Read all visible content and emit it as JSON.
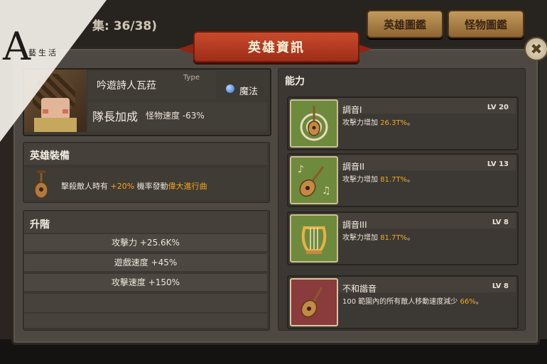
{
  "background": {
    "counter_text": "集: 36/38)",
    "tabs": [
      "英雄圖鑑",
      "怪物圖鑑"
    ]
  },
  "dialog": {
    "title": "英雄資訊",
    "close_glyph": "✖"
  },
  "hero": {
    "name": "吟遊詩人瓦菈",
    "type_label": "Type",
    "type_value": "魔法",
    "leader_label": "隊長加成",
    "leader_effect": "怪物速度 -63%"
  },
  "equipment": {
    "title": "英雄裝備",
    "desc_prefix": "擊殺敵人時有 ",
    "desc_chance": "+20%",
    "desc_middle": " 機率發動",
    "desc_effect": "偉大進行曲"
  },
  "upgrade": {
    "title": "升階",
    "stats": [
      "攻擊力 +25.6K%",
      "遊戲速度 +45%",
      "攻擊速度 +150%"
    ]
  },
  "abilities": {
    "title": "能力",
    "skills": [
      {
        "name": "調音I",
        "level": "LV 20",
        "desc_prefix": "攻擊力增加 ",
        "value": "26.3T%",
        "desc_suffix": "。",
        "icon": "lute-target-icon"
      },
      {
        "name": "調音II",
        "level": "LV 13",
        "desc_prefix": "攻擊力增加 ",
        "value": "81.7T%",
        "desc_suffix": "。",
        "icon": "lute-notes-icon"
      },
      {
        "name": "調音III",
        "level": "LV 8",
        "desc_prefix": "攻擊力增加 ",
        "value": "81.7T%",
        "desc_suffix": "。",
        "icon": "lyre-icon"
      },
      {
        "name": "不和諧音",
        "level": "LV 8",
        "desc_prefix": "100 範圍內的所有敵人移動速度減少 ",
        "value": "66%",
        "desc_suffix": "。",
        "icon": "broken-lute-icon"
      }
    ]
  },
  "watermark": {
    "logo": "A",
    "text": "藝生活"
  },
  "colors": {
    "highlight": "#f3a722",
    "ribbon": "#c94a2c",
    "skill_green": "#6e8a3c",
    "skill_red": "#8a3b3b"
  }
}
